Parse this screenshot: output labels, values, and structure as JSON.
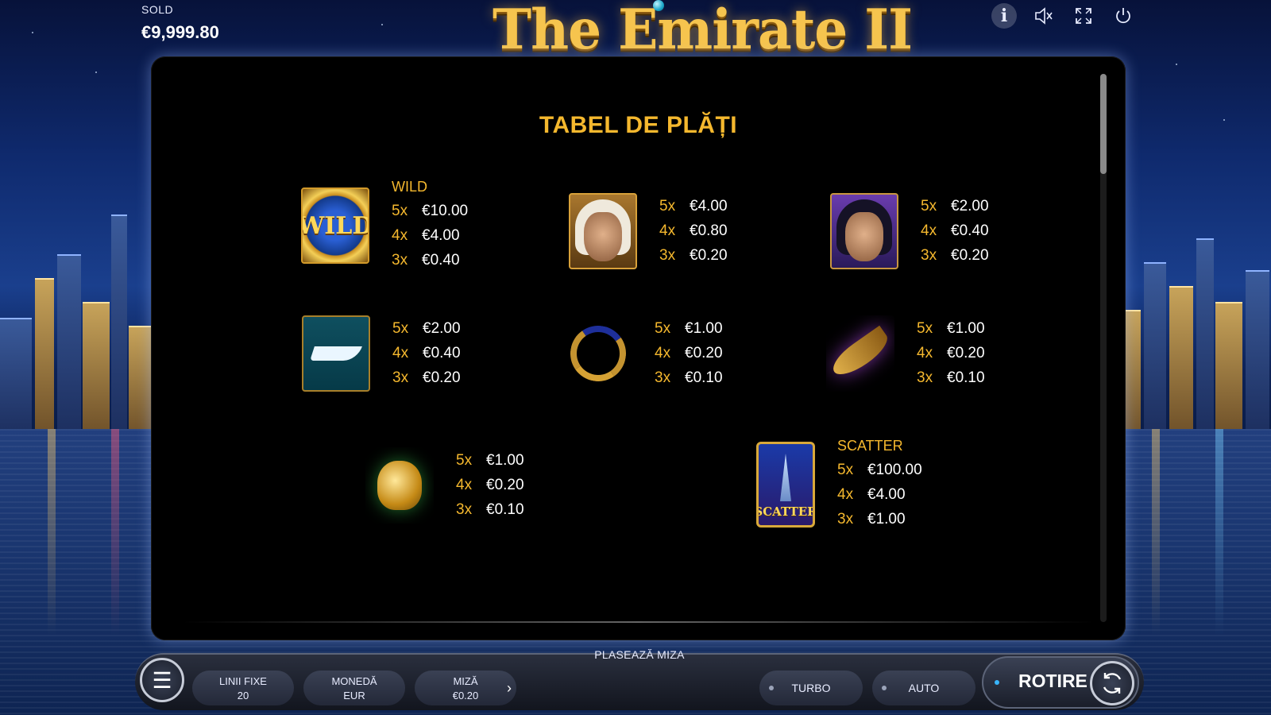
{
  "balance": {
    "label": "SOLD",
    "value": "€9,999.80"
  },
  "game_title": "The Emirate II",
  "top_icons": [
    "info-icon",
    "sound-muted-icon",
    "fullscreen-icon",
    "power-icon"
  ],
  "paytable": {
    "title": "TABEL DE PLĂȚI",
    "symbols": [
      {
        "name": "WILD",
        "icon": "wild-symbol",
        "pays": [
          {
            "count": "5x",
            "value": "€10.00"
          },
          {
            "count": "4x",
            "value": "€4.00"
          },
          {
            "count": "3x",
            "value": "€0.40"
          }
        ]
      },
      {
        "name": "",
        "icon": "sheikh-symbol",
        "pays": [
          {
            "count": "5x",
            "value": "€4.00"
          },
          {
            "count": "4x",
            "value": "€0.80"
          },
          {
            "count": "3x",
            "value": "€0.20"
          }
        ]
      },
      {
        "name": "",
        "icon": "woman-symbol",
        "pays": [
          {
            "count": "5x",
            "value": "€2.00"
          },
          {
            "count": "4x",
            "value": "€0.40"
          },
          {
            "count": "3x",
            "value": "€0.20"
          }
        ]
      },
      {
        "name": "",
        "icon": "yacht-symbol",
        "pays": [
          {
            "count": "5x",
            "value": "€2.00"
          },
          {
            "count": "4x",
            "value": "€0.40"
          },
          {
            "count": "3x",
            "value": "€0.20"
          }
        ]
      },
      {
        "name": "",
        "icon": "necklace-symbol",
        "pays": [
          {
            "count": "5x",
            "value": "€1.00"
          },
          {
            "count": "4x",
            "value": "€0.20"
          },
          {
            "count": "3x",
            "value": "€0.10"
          }
        ]
      },
      {
        "name": "",
        "icon": "dagger-symbol",
        "pays": [
          {
            "count": "5x",
            "value": "€1.00"
          },
          {
            "count": "4x",
            "value": "€0.20"
          },
          {
            "count": "3x",
            "value": "€0.10"
          }
        ]
      },
      {
        "name": "",
        "icon": "teapot-symbol",
        "pays": [
          {
            "count": "5x",
            "value": "€1.00"
          },
          {
            "count": "4x",
            "value": "€0.20"
          },
          {
            "count": "3x",
            "value": "€0.10"
          }
        ]
      },
      {
        "name": "SCATTER",
        "icon": "scatter-symbol",
        "pays": [
          {
            "count": "5x",
            "value": "€100.00"
          },
          {
            "count": "4x",
            "value": "€4.00"
          },
          {
            "count": "3x",
            "value": "€1.00"
          }
        ]
      }
    ]
  },
  "bottom_bar": {
    "caption": "PLASEAZĂ MIZA",
    "lines": {
      "label": "LINII FIXE",
      "value": "20"
    },
    "currency": {
      "label": "MONEDĂ",
      "value": "EUR"
    },
    "bet": {
      "label": "MIZĂ",
      "value": "€0.20"
    },
    "turbo": "TURBO",
    "auto": "AUTO",
    "spin": "ROTIRE"
  },
  "colors": {
    "accent_gold": "#f5b82e",
    "panel_bg": "#000000",
    "spin_dot": "#39b6ff"
  }
}
